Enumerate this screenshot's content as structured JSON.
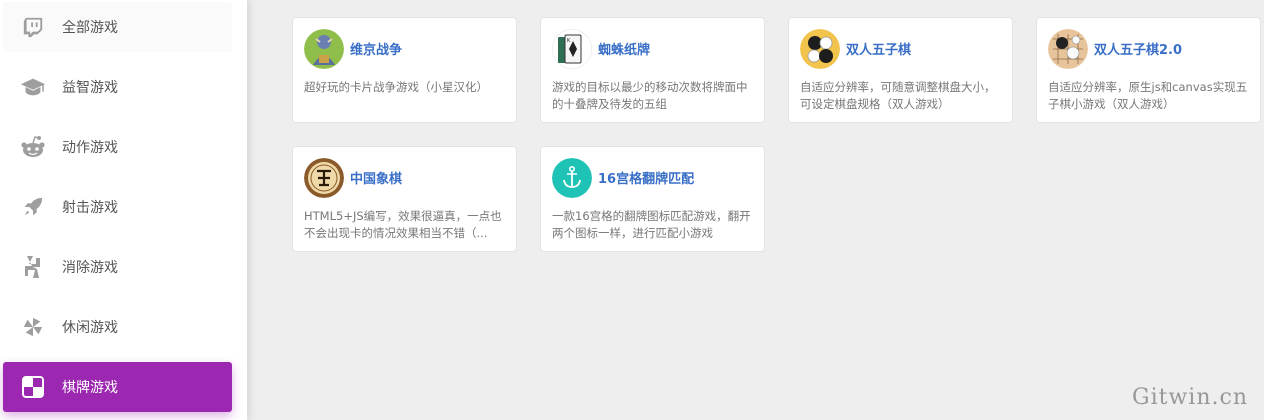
{
  "sidebar": {
    "items": [
      {
        "label": "全部游戏",
        "icon": "twitch-icon"
      },
      {
        "label": "益智游戏",
        "icon": "graduation-cap-icon"
      },
      {
        "label": "动作游戏",
        "icon": "reddit-icon"
      },
      {
        "label": "射击游戏",
        "icon": "rocket-icon"
      },
      {
        "label": "消除游戏",
        "icon": "bolt-shape-icon"
      },
      {
        "label": "休闲游戏",
        "icon": "pinwheel-icon"
      },
      {
        "label": "棋牌游戏",
        "icon": "checker-icon"
      }
    ],
    "active_index": 6,
    "active_color": "#9c27b0"
  },
  "games": [
    {
      "title": "维京战争",
      "desc": "超好玩的卡片战争游戏（小星汉化）",
      "icon": "viking-warrior-icon"
    },
    {
      "title": "蜘蛛纸牌",
      "desc": "游戏的目标以最少的移动次数将牌面中的十叠牌及待发的五组",
      "icon": "playing-card-icon"
    },
    {
      "title": "双人五子棋",
      "desc": "自适应分辨率，可随意调整棋盘大小，可设定棋盘规格（双人游戏）",
      "icon": "gomoku-icon"
    },
    {
      "title": "双人五子棋2.0",
      "desc": "自适应分辨率，原生js和canvas实现五子棋小游戏（双人游戏）",
      "icon": "go-board-icon"
    },
    {
      "title": "中国象棋",
      "desc": "HTML5+JS编写，效果很逼真，一点也不会出现卡的情况效果相当不错（...",
      "icon": "xiangqi-piece-icon"
    },
    {
      "title": "16宫格翻牌匹配",
      "desc": "一款16宫格的翻牌图标匹配游戏，翻开两个图标一样，进行匹配小游戏",
      "icon": "anchor-icon"
    }
  ],
  "watermark": "Gitwin.cn",
  "colors": {
    "title": "#3a6fc8",
    "anchor_bg": "#1ec3b5"
  }
}
